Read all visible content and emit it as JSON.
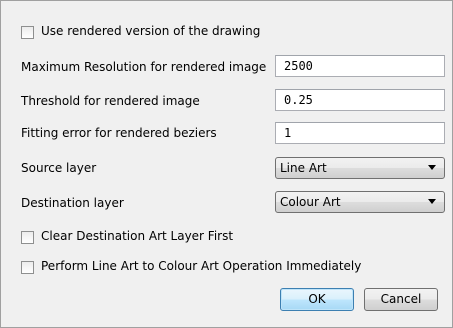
{
  "options": {
    "use_rendered": {
      "label": "Use rendered version of the drawing",
      "checked": false
    },
    "clear_destination": {
      "label": "Clear Destination Art Layer First",
      "checked": false
    },
    "perform_immediately": {
      "label": "Perform Line Art to Colour Art Operation Immediately",
      "checked": false
    }
  },
  "fields": {
    "max_resolution": {
      "label": "Maximum Resolution for rendered image",
      "value": "2500"
    },
    "threshold": {
      "label": "Threshold for rendered image",
      "value": "0.25"
    },
    "fitting_error": {
      "label": "Fitting error for rendered beziers",
      "value": "1"
    }
  },
  "layers": {
    "source": {
      "label": "Source layer",
      "value": "Line Art"
    },
    "destination": {
      "label": "Destination layer",
      "value": "Colour Art"
    }
  },
  "buttons": {
    "ok": "OK",
    "cancel": "Cancel"
  },
  "icons": {
    "dropdown": "chevron-down-icon"
  }
}
